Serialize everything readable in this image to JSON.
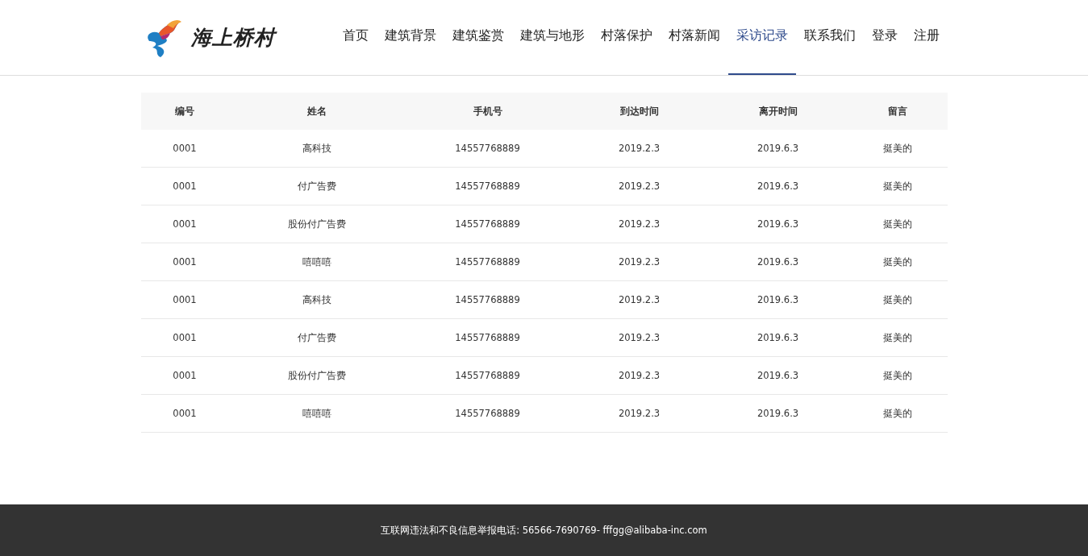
{
  "logo": {
    "text": "海上桥村"
  },
  "nav": [
    {
      "label": "首页",
      "selected": false
    },
    {
      "label": "建筑背景",
      "selected": false
    },
    {
      "label": "建筑鉴赏",
      "selected": false
    },
    {
      "label": "建筑与地形",
      "selected": false
    },
    {
      "label": "村落保护",
      "selected": false
    },
    {
      "label": "村落新闻",
      "selected": false
    },
    {
      "label": "采访记录",
      "selected": true
    },
    {
      "label": "联系我们",
      "selected": false
    },
    {
      "label": "登录",
      "selected": false
    },
    {
      "label": "注册",
      "selected": false
    }
  ],
  "table": {
    "columns": [
      "编号",
      "姓名",
      "手机号",
      "到达时间",
      "离开时间",
      "留言"
    ],
    "rows": [
      [
        "0001",
        "高科技",
        "14557768889",
        "2019.2.3",
        "2019.6.3",
        "挺美的"
      ],
      [
        "0001",
        "付广告费",
        "14557768889",
        "2019.2.3",
        "2019.6.3",
        "挺美的"
      ],
      [
        "0001",
        "股份付广告费",
        "14557768889",
        "2019.2.3",
        "2019.6.3",
        "挺美的"
      ],
      [
        "0001",
        "嘻嘻嘻",
        "14557768889",
        "2019.2.3",
        "2019.6.3",
        "挺美的"
      ],
      [
        "0001",
        "高科技",
        "14557768889",
        "2019.2.3",
        "2019.6.3",
        "挺美的"
      ],
      [
        "0001",
        "付广告费",
        "14557768889",
        "2019.2.3",
        "2019.6.3",
        "挺美的"
      ],
      [
        "0001",
        "股份付广告费",
        "14557768889",
        "2019.2.3",
        "2019.6.3",
        "挺美的"
      ],
      [
        "0001",
        "嘻嘻嘻",
        "14557768889",
        "2019.2.3",
        "2019.6.3",
        "挺美的"
      ]
    ]
  },
  "footer": {
    "text": "互联网违法和不良信息举报电话: 56566-7690769- fffgg@alibaba-inc.com"
  }
}
